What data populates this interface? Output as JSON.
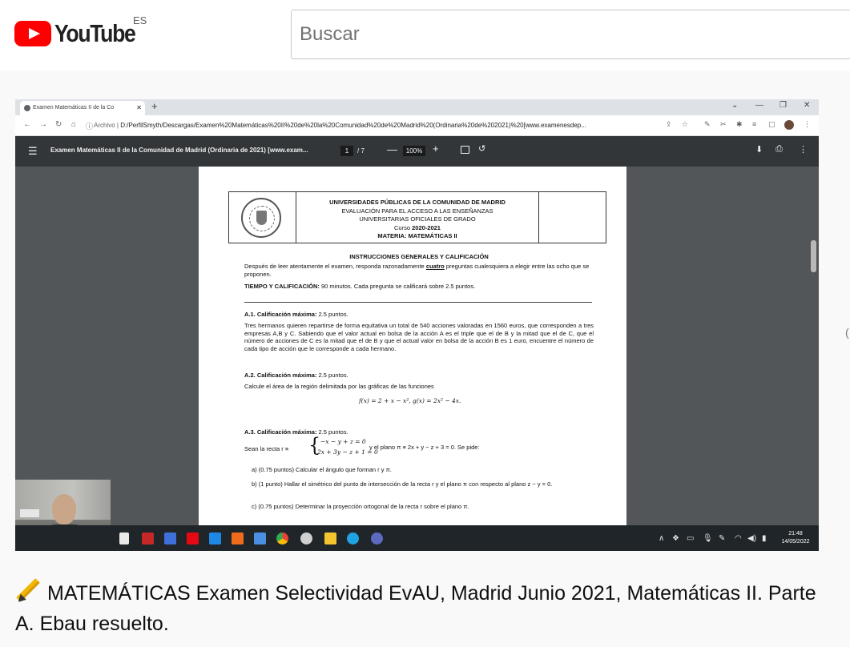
{
  "header": {
    "logo_text": "YouTube",
    "region": "ES",
    "search_placeholder": "Buscar"
  },
  "browser": {
    "tab_title": "Examen Matemáticas II de la Co",
    "url_scheme": "Archivo",
    "url_path": "D:/PerfilSmyth/Descargas/Examen%20Matemáticas%20II%20de%20la%20Comunidad%20de%20Madrid%20(Ordinaria%20de%202021)%20[www.examenesdep..."
  },
  "pdf_toolbar": {
    "title": "Examen Matemáticas II de la Comunidad de Madrid (Ordinaria de 2021) [www.exam...",
    "page_current": "1",
    "page_total": "/ 7",
    "zoom": "100%"
  },
  "pdf_page": {
    "header_line1": "UNIVERSIDADES PÚBLICAS DE LA COMUNIDAD DE MADRID",
    "header_line2": "EVALUACIÓN PARA EL ACCESO A LAS ENSEÑANZAS",
    "header_line3": "UNIVERSITARIAS OFICIALES DE GRADO",
    "header_line4_prefix": "Curso ",
    "header_line4_year": "2020-2021",
    "header_line5": "MATERIA: MATEMÁTICAS II",
    "instructions_title": "INSTRUCCIONES GENERALES Y CALIFICACIÓN",
    "instructions_a": "Después de leer atentamente el examen, responda razonadamente ",
    "instructions_bold": "cuatro",
    "instructions_b": " preguntas cualesquiera a elegir entre las ocho que se proponen.",
    "time_label": "TIEMPO Y CALIFICACIÓN:",
    "time_text": " 90 minutos. Cada pregunta se calificará sobre 2.5 puntos.",
    "a1_label": "A.1. Calificación máxima:",
    "a1_points": " 2.5 puntos.",
    "a1_text": "Tres hermanos quieren repartirse de forma equitativa un total de 540 acciones valoradas en 1560 euros, que corresponden a tres empresas A,B y C. Sabiendo que el valor actual en bolsa de la acción A es el triple que el de B y la mitad que el de C, que el número de acciones de C es la mitad que el de B y que el actual valor en bolsa de la acción B es 1 euro, encuentre el número de cada tipo de acción que le corresponde a cada hermano.",
    "a2_label": "A.2. Calificación máxima:",
    "a2_points": " 2.5 puntos.",
    "a2_text": "Calcule el área de la región delimitada por las gráficas de las funciones",
    "a2_formula": "f(x) = 2 + x − x²,   g(x) = 2x² − 4x.",
    "a3_label": "A.3. Calificación máxima:",
    "a3_points": " 2.5 puntos.",
    "a3_prefix": "Sean la recta r ≡",
    "a3_eq1": "−x − y + z = 0",
    "a3_eq2": "2x + 3y − z + 1 = 0",
    "a3_suffix": "y el plano π ≡ 2x + y − z + 3 = 0. Se pide:",
    "a3_a": "a)  (0.75 puntos) Calcular el ángulo que forman r y π.",
    "a3_b": "b)  (1 punto) Hallar el simétrico del punto de intersección de la recta r y el plano π con respecto al plano z − y = 0.",
    "a3_c": "c)  (0.75 puntos) Determinar la proyección ortogonal de la recta r sobre el plano π."
  },
  "taskbar": {
    "time": "21:48",
    "date": "14/05/2022"
  },
  "video": {
    "title": "MATEMÁTICAS Examen Selectividad EvAU, Madrid Junio 2021, Matemáticas II. Parte A. Ebau resuelto."
  }
}
